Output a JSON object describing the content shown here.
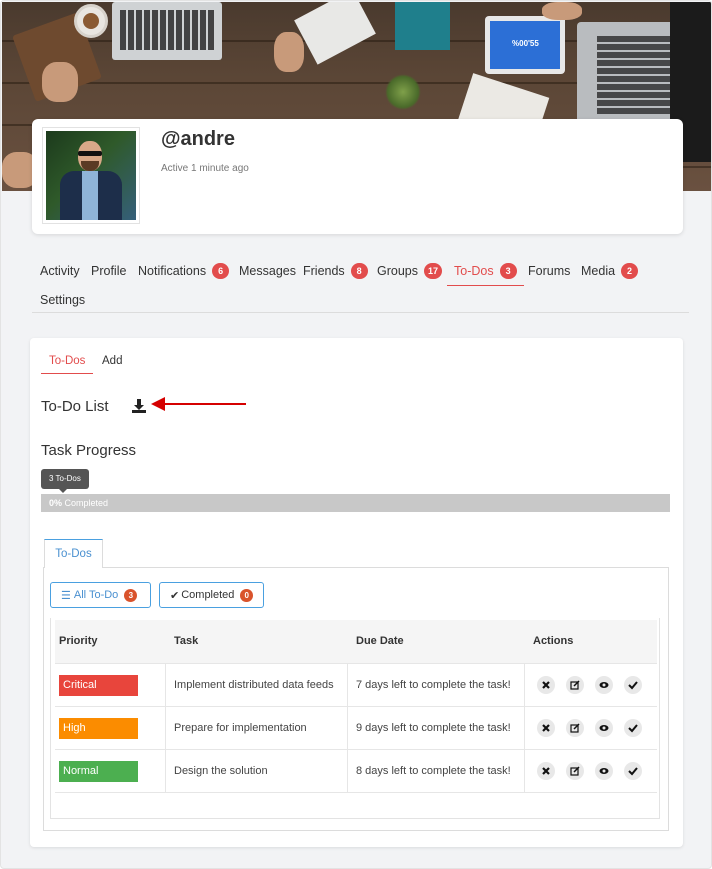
{
  "profile": {
    "username": "@andre",
    "last_active": "Active 1 minute ago"
  },
  "cover": {
    "tablet_text": "%00'55"
  },
  "nav": {
    "items": [
      {
        "label": "Activity",
        "badge": null
      },
      {
        "label": "Profile",
        "badge": null
      },
      {
        "label": "Notifications",
        "badge": "6"
      },
      {
        "label": "Messages",
        "badge": null
      },
      {
        "label": "Friends",
        "badge": "8"
      },
      {
        "label": "Groups",
        "badge": "17"
      },
      {
        "label": "To-Dos",
        "badge": "3",
        "active": true
      },
      {
        "label": "Forums",
        "badge": null
      },
      {
        "label": "Media",
        "badge": "2"
      },
      {
        "label": "Settings",
        "badge": null
      }
    ]
  },
  "subtabs": {
    "todos": "To-Dos",
    "add": "Add"
  },
  "todo_list": {
    "title": "To-Do List",
    "download_icon": "download-icon"
  },
  "progress": {
    "title": "Task Progress",
    "tooltip": "3 To-Dos",
    "percent_label": "0%",
    "completed_label": "Completed",
    "fraction": 0
  },
  "inner_tab": {
    "label": "To-Dos"
  },
  "filters": {
    "all": {
      "label": "All To-Do",
      "count": "3"
    },
    "completed": {
      "label": "Completed",
      "count": "0"
    }
  },
  "table": {
    "headers": {
      "priority": "Priority",
      "task": "Task",
      "due": "Due Date",
      "actions": "Actions"
    },
    "rows": [
      {
        "priority": "Critical",
        "color": "#e8453c",
        "task": "Implement distributed data feeds",
        "due": "7 days left to complete the task!"
      },
      {
        "priority": "High",
        "color": "#fb8c00",
        "task": "Prepare for implementation",
        "due": "9 days left to complete the task!"
      },
      {
        "priority": "Normal",
        "color": "#4caf50",
        "task": "Design the solution",
        "due": "8 days left to complete the task!"
      }
    ]
  },
  "colors": {
    "accent": "#e24c4c",
    "link": "#4a90d0"
  }
}
